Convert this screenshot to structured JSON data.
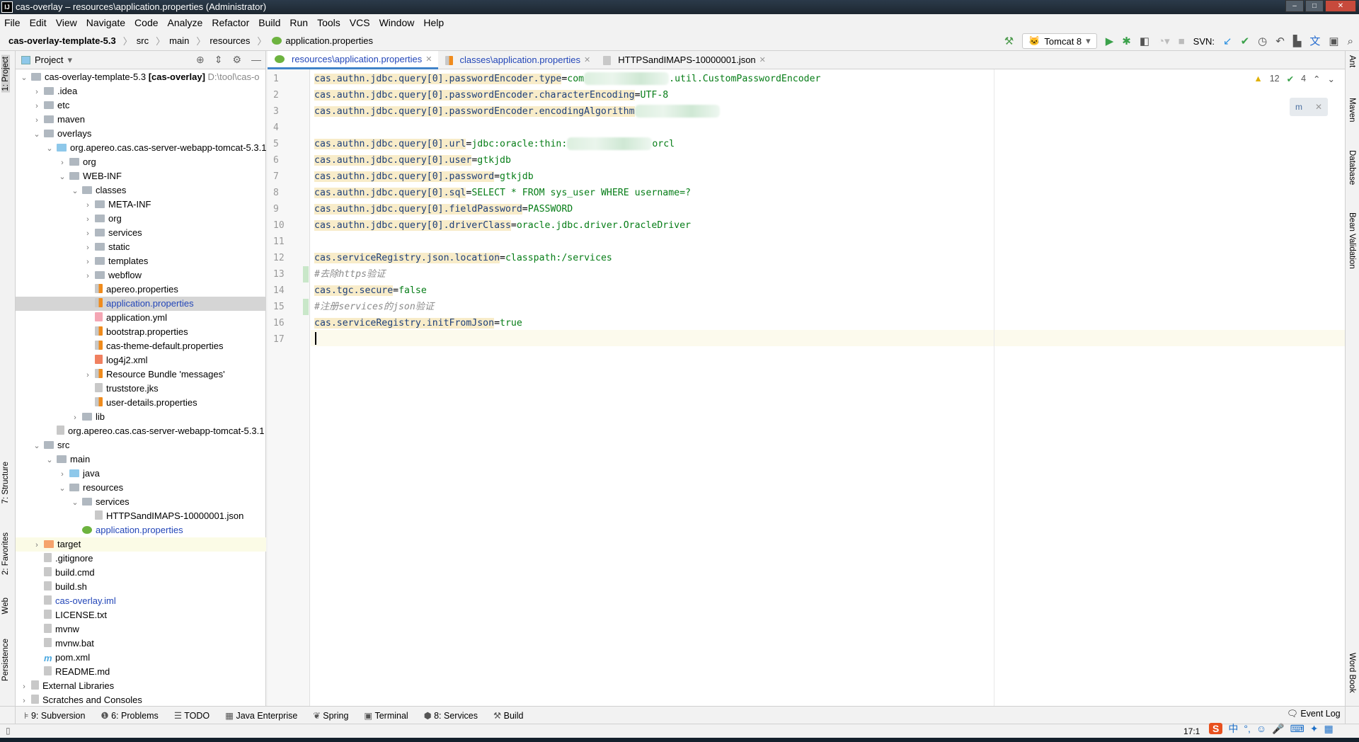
{
  "window": {
    "title": "cas-overlay – resources\\application.properties (Administrator)",
    "logo": "IJ",
    "controls": [
      "minimize",
      "maximize",
      "close"
    ]
  },
  "menu": [
    "File",
    "Edit",
    "View",
    "Navigate",
    "Code",
    "Analyze",
    "Refactor",
    "Build",
    "Run",
    "Tools",
    "VCS",
    "Window",
    "Help"
  ],
  "breadcrumb": [
    "cas-overlay-template-5.3",
    "src",
    "main",
    "resources",
    "application.properties"
  ],
  "toolbar": {
    "run_config": "Tomcat 8",
    "svn_label": "SVN:",
    "icons": [
      "hammer-icon",
      "run-icon",
      "debug-icon",
      "coverage-icon",
      "profile-icon",
      "stop-icon",
      "svn-update-icon",
      "svn-commit-icon",
      "history-icon",
      "revert-icon",
      "project-structure-icon",
      "translate-icon",
      "presentation-icon",
      "search-icon"
    ]
  },
  "left_stripe": [
    "1: Project",
    "7: Structure",
    "2: Favorites",
    "Web",
    "Persistence"
  ],
  "right_stripe": [
    "Ant",
    "Maven",
    "Database",
    "Bean Validation",
    "Word Book"
  ],
  "project": {
    "title": "Project",
    "tree": [
      {
        "level": 0,
        "arrow": "v",
        "icon": "module",
        "name": "cas-overlay-template-5.3",
        "bold": "[cas-overlay]",
        "path": "D:\\tool\\cas-o"
      },
      {
        "level": 1,
        "arrow": ">",
        "icon": "folder",
        "name": ".idea"
      },
      {
        "level": 1,
        "arrow": ">",
        "icon": "folder",
        "name": "etc"
      },
      {
        "level": 1,
        "arrow": ">",
        "icon": "folder",
        "name": "maven"
      },
      {
        "level": 1,
        "arrow": "v",
        "icon": "folder",
        "name": "overlays"
      },
      {
        "level": 2,
        "arrow": "v",
        "icon": "folder-src",
        "name": "org.apereo.cas.cas-server-webapp-tomcat-5.3.1"
      },
      {
        "level": 3,
        "arrow": ">",
        "icon": "folder",
        "name": "org"
      },
      {
        "level": 3,
        "arrow": "v",
        "icon": "folder",
        "name": "WEB-INF"
      },
      {
        "level": 4,
        "arrow": "v",
        "icon": "folder",
        "name": "classes"
      },
      {
        "level": 5,
        "arrow": ">",
        "icon": "folder",
        "name": "META-INF"
      },
      {
        "level": 5,
        "arrow": ">",
        "icon": "folder",
        "name": "org"
      },
      {
        "level": 5,
        "arrow": ">",
        "icon": "folder",
        "name": "services"
      },
      {
        "level": 5,
        "arrow": ">",
        "icon": "folder",
        "name": "static"
      },
      {
        "level": 5,
        "arrow": ">",
        "icon": "folder",
        "name": "templates"
      },
      {
        "level": 5,
        "arrow": ">",
        "icon": "folder",
        "name": "webflow"
      },
      {
        "level": 5,
        "arrow": "",
        "icon": "prop",
        "name": "apereo.properties"
      },
      {
        "level": 5,
        "arrow": "",
        "icon": "prop",
        "name": "application.properties",
        "selected": true,
        "blue": true
      },
      {
        "level": 5,
        "arrow": "",
        "icon": "yml",
        "name": "application.yml"
      },
      {
        "level": 5,
        "arrow": "",
        "icon": "prop",
        "name": "bootstrap.properties"
      },
      {
        "level": 5,
        "arrow": "",
        "icon": "prop",
        "name": "cas-theme-default.properties"
      },
      {
        "level": 5,
        "arrow": "",
        "icon": "xml",
        "name": "log4j2.xml"
      },
      {
        "level": 5,
        "arrow": ">",
        "icon": "prop",
        "name": "Resource Bundle 'messages'"
      },
      {
        "level": 5,
        "arrow": "",
        "icon": "file",
        "name": "truststore.jks"
      },
      {
        "level": 5,
        "arrow": "",
        "icon": "prop",
        "name": "user-details.properties"
      },
      {
        "level": 4,
        "arrow": ">",
        "icon": "folder",
        "name": "lib"
      },
      {
        "level": 2,
        "arrow": "",
        "icon": "file",
        "name": "org.apereo.cas.cas-server-webapp-tomcat-5.3.1"
      },
      {
        "level": 1,
        "arrow": "v",
        "icon": "folder",
        "name": "src"
      },
      {
        "level": 2,
        "arrow": "v",
        "icon": "folder",
        "name": "main"
      },
      {
        "level": 3,
        "arrow": ">",
        "icon": "folder-src",
        "name": "java"
      },
      {
        "level": 3,
        "arrow": "v",
        "icon": "folder",
        "name": "resources"
      },
      {
        "level": 4,
        "arrow": "v",
        "icon": "folder",
        "name": "services"
      },
      {
        "level": 5,
        "arrow": "",
        "icon": "file",
        "name": "HTTPSandIMAPS-10000001.json"
      },
      {
        "level": 4,
        "arrow": "",
        "icon": "spring",
        "name": "application.properties",
        "blue": true
      },
      {
        "level": 1,
        "arrow": ">",
        "icon": "folder-target",
        "name": "target",
        "highlight": true
      },
      {
        "level": 1,
        "arrow": "",
        "icon": "file",
        "name": ".gitignore"
      },
      {
        "level": 1,
        "arrow": "",
        "icon": "file",
        "name": "build.cmd"
      },
      {
        "level": 1,
        "arrow": "",
        "icon": "file",
        "name": "build.sh"
      },
      {
        "level": 1,
        "arrow": "",
        "icon": "file",
        "name": "cas-overlay.iml",
        "blue": true
      },
      {
        "level": 1,
        "arrow": "",
        "icon": "file",
        "name": "LICENSE.txt"
      },
      {
        "level": 1,
        "arrow": "",
        "icon": "file",
        "name": "mvnw"
      },
      {
        "level": 1,
        "arrow": "",
        "icon": "file",
        "name": "mvnw.bat"
      },
      {
        "level": 1,
        "arrow": "",
        "icon": "maven",
        "name": "pom.xml"
      },
      {
        "level": 1,
        "arrow": "",
        "icon": "file",
        "name": "README.md"
      },
      {
        "level": 0,
        "arrow": ">",
        "icon": "libs",
        "name": "External Libraries"
      },
      {
        "level": 0,
        "arrow": ">",
        "icon": "scratch",
        "name": "Scratches and Consoles"
      }
    ]
  },
  "tabs": [
    {
      "label": "resources\\application.properties",
      "active": true,
      "icon": "spring"
    },
    {
      "label": "classes\\application.properties",
      "active": false,
      "icon": "prop"
    },
    {
      "label": "HTTPSandIMAPS-10000001.json",
      "active": false,
      "icon": "json"
    }
  ],
  "editor": {
    "warnings": "12",
    "typos": "4",
    "maven_popup": "m",
    "lines": [
      {
        "key": "cas.authn.jdbc.query[0].passwordEncoder.type",
        "value": [
          "com",
          {
            "blur": 1
          },
          ".util.CustomPasswordEncoder"
        ]
      },
      {
        "key": "cas.authn.jdbc.query[0].passwordEncoder.characterEncoding",
        "value": [
          "UTF-8"
        ]
      },
      {
        "key": "cas.authn.jdbc.query[0].passwordEncoder.encodingAlgorithm",
        "value": [
          {
            "blur": 1
          }
        ],
        "noeq": true
      },
      {},
      {
        "key": "cas.authn.jdbc.query[0].url",
        "value": [
          "jdbc:oracle:thin:",
          {
            "blur": 1
          },
          "orcl"
        ]
      },
      {
        "key": "cas.authn.jdbc.query[0].user",
        "value": [
          "gtkjdb"
        ]
      },
      {
        "key": "cas.authn.jdbc.query[0].password",
        "value": [
          "gtkjdb"
        ]
      },
      {
        "key": "cas.authn.jdbc.query[0].sql",
        "value": [
          "SELECT * FROM sys_user WHERE username=?"
        ]
      },
      {
        "key": "cas.authn.jdbc.query[0].fieldPassword",
        "value": [
          "PASSWORD"
        ]
      },
      {
        "key": "cas.authn.jdbc.query[0].driverClass",
        "value": [
          "oracle.jdbc.driver.OracleDriver"
        ]
      },
      {},
      {
        "key": "cas.serviceRegistry.json.location",
        "value": [
          "classpath:/services"
        ]
      },
      {
        "comment": "#去除https验证",
        "changed": true
      },
      {
        "key": "cas.tgc.secure",
        "value": [
          "false"
        ]
      },
      {
        "comment": "#注册services的json验证",
        "changed": true
      },
      {
        "key": "cas.serviceRegistry.initFromJson",
        "value": [
          "true"
        ]
      },
      {}
    ]
  },
  "bottom_tools": [
    "9: Subversion",
    "6: Problems",
    "TODO",
    "Java Enterprise",
    "Spring",
    "Terminal",
    "8: Services",
    "Build"
  ],
  "status": {
    "event_log": "Event Log",
    "position": "17:1",
    "ime": "中"
  }
}
